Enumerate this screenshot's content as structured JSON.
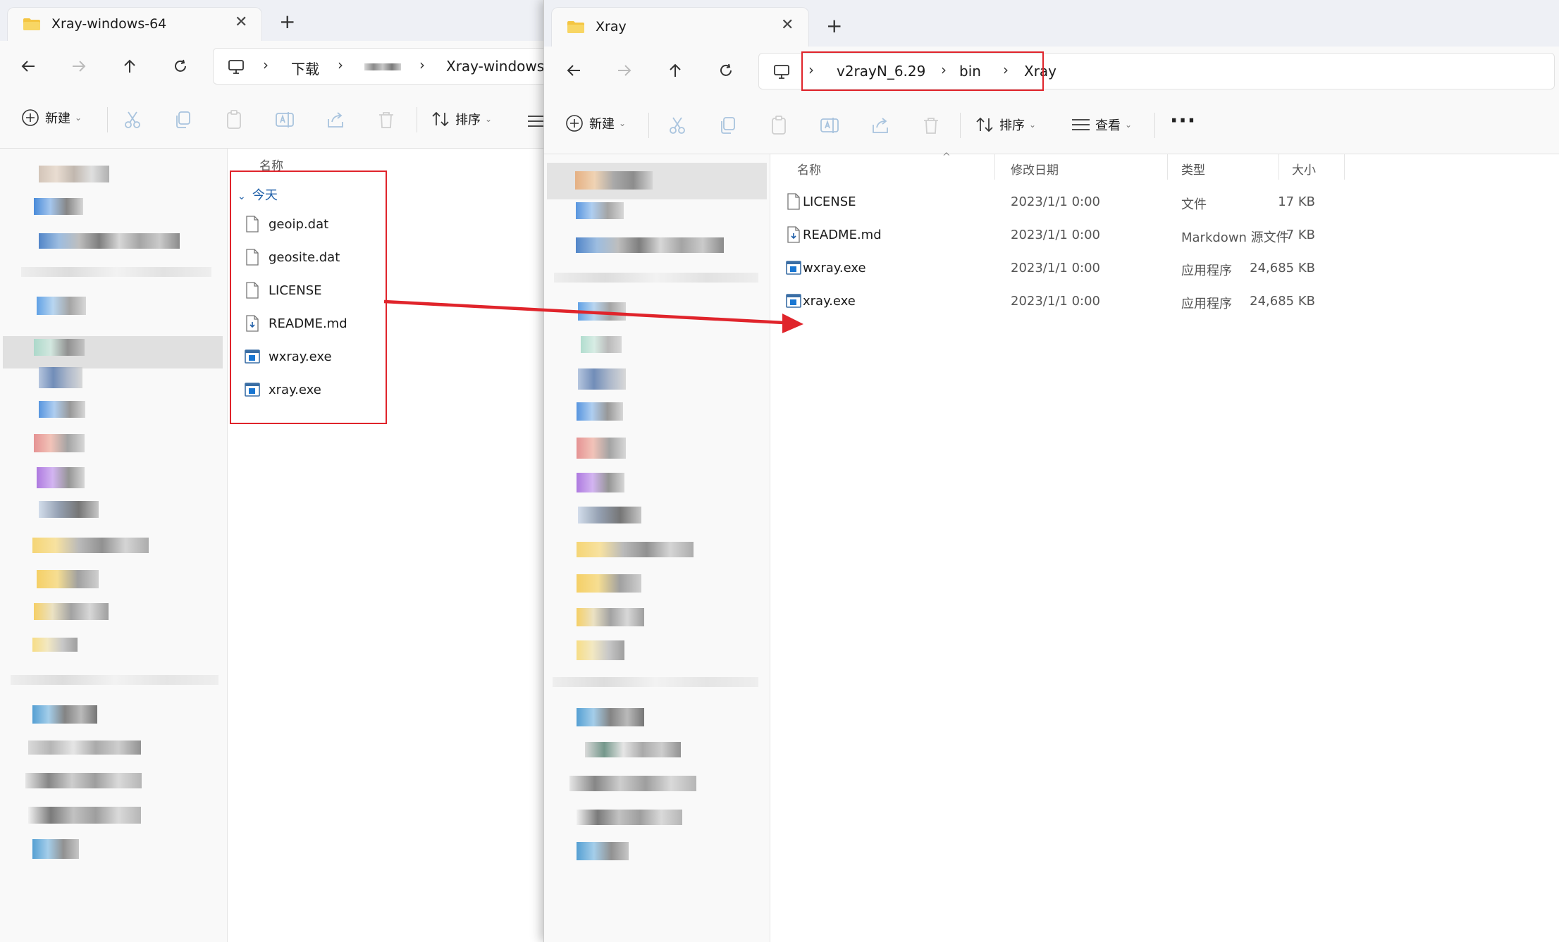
{
  "left_window": {
    "tab_title": "Xray-windows-64",
    "breadcrumb": [
      "下载",
      "Xray-windows-"
    ],
    "toolbar": {
      "new_label": "新建",
      "sort_label": "排序"
    },
    "column_header": "名称",
    "group_label": "今天",
    "files": [
      {
        "name": "geoip.dat",
        "icon": "blank-file-icon"
      },
      {
        "name": "geosite.dat",
        "icon": "blank-file-icon"
      },
      {
        "name": "LICENSE",
        "icon": "blank-file-icon"
      },
      {
        "name": "README.md",
        "icon": "markdown-file-icon"
      },
      {
        "name": "wxray.exe",
        "icon": "exe-icon"
      },
      {
        "name": "xray.exe",
        "icon": "exe-icon"
      }
    ]
  },
  "right_window": {
    "tab_title": "Xray",
    "breadcrumb": [
      "v2rayN_6.29",
      "bin",
      "Xray"
    ],
    "toolbar": {
      "new_label": "新建",
      "sort_label": "排序",
      "view_label": "查看",
      "more_label": "···"
    },
    "columns": {
      "name": "名称",
      "date": "修改日期",
      "type": "类型",
      "size": "大小"
    },
    "files": [
      {
        "name": "LICENSE",
        "date": "2023/1/1 0:00",
        "type": "文件",
        "size": "17 KB",
        "icon": "blank-file-icon"
      },
      {
        "name": "README.md",
        "date": "2023/1/1 0:00",
        "type": "Markdown 源文件",
        "size": "7 KB",
        "icon": "markdown-file-icon"
      },
      {
        "name": "wxray.exe",
        "date": "2023/1/1 0:00",
        "type": "应用程序",
        "size": "24,685 KB",
        "icon": "exe-icon"
      },
      {
        "name": "xray.exe",
        "date": "2023/1/1 0:00",
        "type": "应用程序",
        "size": "24,685 KB",
        "icon": "exe-icon"
      }
    ]
  },
  "colors": {
    "annotation_red": "#e0242b",
    "accent_blue": "#0f6cbd",
    "folder_yellow": "#f4c542"
  }
}
